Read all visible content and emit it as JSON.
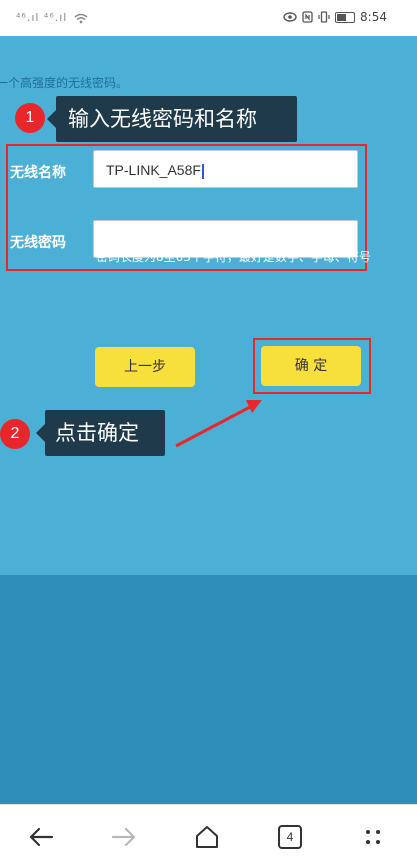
{
  "status_bar": {
    "signal_left": "⁴⁶.ıl ⁴⁶.ıl",
    "wifi_icon": "wifi-icon",
    "time": "8:54"
  },
  "page": {
    "top_hint": "一个高强度的无线密码。",
    "ssid_label": "无线名称",
    "ssid_value": "TP-LINK_A58F",
    "password_label": "无线密码",
    "password_value": "",
    "password_hint": "密码长度为8至63个字符，最好是数字、字母、符号",
    "prev_button": "上一步",
    "confirm_button": "确 定"
  },
  "annotations": {
    "step1_number": "1",
    "step1_text": "输入无线密码和名称",
    "step2_number": "2",
    "step2_text": "点击确定"
  },
  "nav": {
    "tabs_count": "4"
  },
  "colors": {
    "content_bg": "#4cb0d6",
    "content_bottom_bg": "#2f8fba",
    "button_yellow": "#f7df3c",
    "highlight_red": "#e8272b",
    "callout_bg": "#1f3a4a"
  }
}
